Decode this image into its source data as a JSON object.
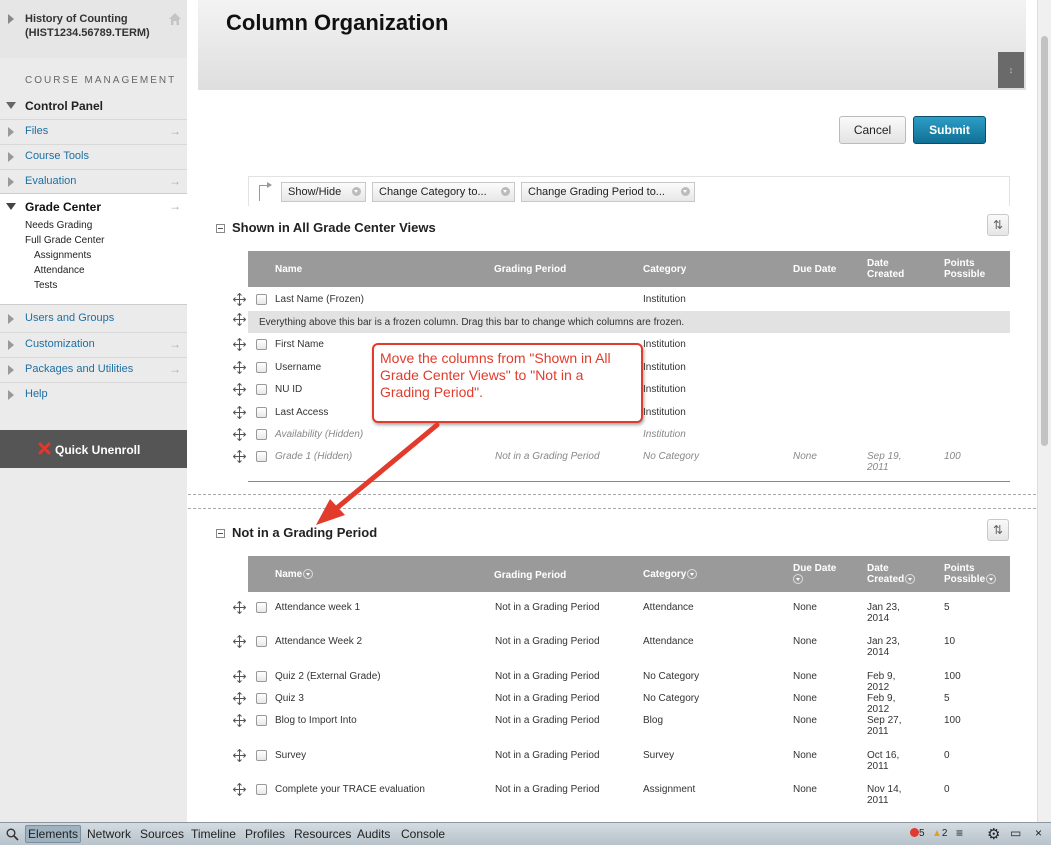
{
  "course": {
    "title": "History of Counting (HIST1234.56789.TERM)"
  },
  "sidebar": {
    "section_label": "COURSE MANAGEMENT",
    "control_panel": "Control Panel",
    "items": [
      {
        "label": "Files"
      },
      {
        "label": "Course Tools"
      },
      {
        "label": "Evaluation"
      }
    ],
    "grade_center": {
      "label": "Grade Center",
      "subitems": [
        "Needs Grading",
        "Full Grade Center",
        "Assignments",
        "Attendance",
        "Tests"
      ]
    },
    "items_after": [
      {
        "label": "Users and Groups"
      },
      {
        "label": "Customization"
      },
      {
        "label": "Packages and Utilities"
      },
      {
        "label": "Help"
      }
    ],
    "quick_unenroll": "Quick Unenroll"
  },
  "page": {
    "title": "Column Organization"
  },
  "buttons": {
    "cancel": "Cancel",
    "submit": "Submit"
  },
  "toolbar": {
    "show_hide": "Show/Hide",
    "change_category": "Change Category to...",
    "change_grading_period": "Change Grading Period to..."
  },
  "columns": {
    "name": "Name",
    "grading_period": "Grading Period",
    "category": "Category",
    "due_date": "Due Date",
    "date_created": "Date Created",
    "points_possible": "Points Possible"
  },
  "section1": {
    "title": "Shown in All Grade Center Views",
    "frozen_rows": [
      {
        "name": "Last Name (Frozen)",
        "grading_period": "",
        "category": "Institution",
        "due": "",
        "created": "",
        "points": "",
        "hidden": false
      }
    ],
    "frozen_bar": "Everything above this bar is a frozen column. Drag this bar to change which columns are frozen.",
    "rows": [
      {
        "name": "First Name",
        "grading_period": "",
        "category": "Institution",
        "due": "",
        "created": "",
        "points": "",
        "hidden": false
      },
      {
        "name": "Username",
        "grading_period": "",
        "category": "Institution",
        "due": "",
        "created": "",
        "points": "",
        "hidden": false
      },
      {
        "name": "NU ID",
        "grading_period": "",
        "category": "Institution",
        "due": "",
        "created": "",
        "points": "",
        "hidden": false
      },
      {
        "name": "Last Access",
        "grading_period": "",
        "category": "Institution",
        "due": "",
        "created": "",
        "points": "",
        "hidden": false
      },
      {
        "name": "Availability (Hidden)",
        "grading_period": "",
        "category": "Institution",
        "due": "",
        "created": "",
        "points": "",
        "hidden": true
      },
      {
        "name": "Grade 1 (Hidden)",
        "grading_period": "Not in a Grading Period",
        "category": "No Category",
        "due": "None",
        "created": "Sep 19, 2011",
        "points": "100",
        "hidden": true
      }
    ]
  },
  "section2": {
    "title": "Not in a Grading Period",
    "rows": [
      {
        "name": "Attendance week 1",
        "grading_period": "Not in a Grading Period",
        "category": "Attendance",
        "due": "None",
        "created": "Jan 23, 2014",
        "points": "5"
      },
      {
        "name": "Attendance Week 2",
        "grading_period": "Not in a Grading Period",
        "category": "Attendance",
        "due": "None",
        "created": "Jan 23, 2014",
        "points": "10"
      },
      {
        "name": "Quiz 2 (External Grade)",
        "grading_period": "Not in a Grading Period",
        "category": "No Category",
        "due": "None",
        "created": "Feb 9, 2012",
        "points": "100"
      },
      {
        "name": "Quiz 3",
        "grading_period": "Not in a Grading Period",
        "category": "No Category",
        "due": "None",
        "created": "Feb 9, 2012",
        "points": "5"
      },
      {
        "name": "Blog to Import Into",
        "grading_period": "Not in a Grading Period",
        "category": "Blog",
        "due": "None",
        "created": "Sep 27, 2011",
        "points": "100"
      },
      {
        "name": "Survey",
        "grading_period": "Not in a Grading Period",
        "category": "Survey",
        "due": "None",
        "created": "Oct 16, 2011",
        "points": "0"
      },
      {
        "name": "Complete your TRACE evaluation",
        "grading_period": "Not in a Grading Period",
        "category": "Assignment",
        "due": "None",
        "created": "Nov 14, 2011",
        "points": "0"
      }
    ]
  },
  "callout": {
    "text": "Move the columns from \"Shown in All Grade Center Views\" to \"Not in a Grading Period\"."
  },
  "devtools": {
    "tabs": [
      "Elements",
      "Network",
      "Sources",
      "Timeline",
      "Profiles",
      "Resources",
      "Audits",
      "Console"
    ],
    "error_count": "5",
    "warning_count": "2"
  },
  "colors": {
    "link": "#1c6fa3",
    "submit": "#1a7fa8",
    "callout": "#e23b2b",
    "header_gray": "#9a9a9a"
  }
}
